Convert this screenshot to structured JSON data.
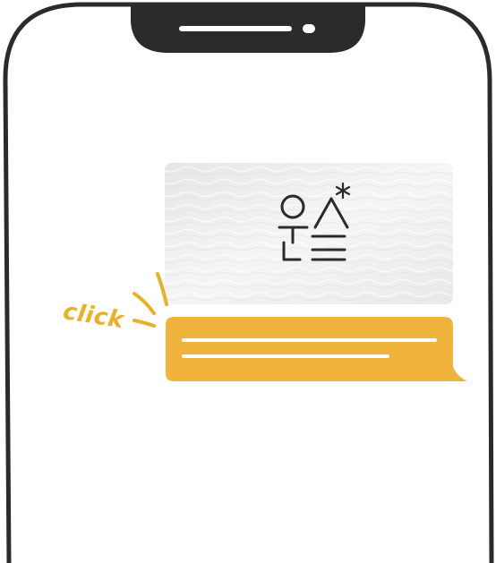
{
  "colors": {
    "frame": "#2b2b2b",
    "accent": "#e9b127",
    "bubble": "#f0b43c",
    "bubble_lines": "#ffffff",
    "image_bg": "#efefef",
    "glyph": "#2b2b2b"
  },
  "annotation": {
    "click_text": "click"
  },
  "image_card": {
    "icon": "hangul-logo-icon"
  },
  "message_bubble": {
    "text_lines": 2
  }
}
